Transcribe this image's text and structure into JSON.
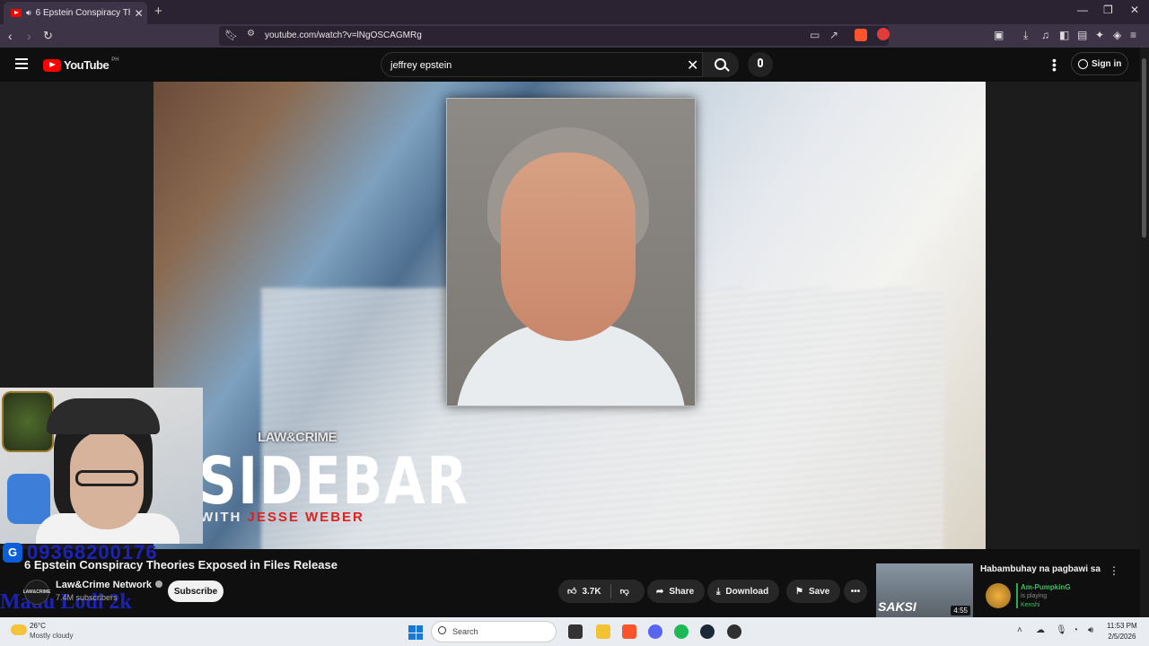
{
  "browser": {
    "tab_title": "6 Epstein Conspiracy Theorie",
    "url": "youtube.com/watch?v=lNgOSCAGMRg"
  },
  "youtube": {
    "logo_text": "YouTube",
    "country_code": "PH",
    "search_query": "jeffrey epstein",
    "sign_in": "Sign in"
  },
  "video": {
    "brand": "LAW&CRIME",
    "show_title": "SIDEBAR",
    "with_text": "WITH",
    "host": "JESSE WEBER",
    "title": "6 Epstein Conspiracy Theories Exposed in Files Release",
    "channel_name": "Law&Crime Network",
    "channel_avatar_text": "LAW&CRIME",
    "subscribers": "7.4M subscribers",
    "subscribe_label": "Subscribe",
    "likes": "3.7K",
    "share_label": "Share",
    "download_label": "Download",
    "save_label": "Save"
  },
  "overlay": {
    "number": "09368200176",
    "lodi": "Mauu Lodi 2k"
  },
  "mini_player": {
    "title": "Habambuhay na pagbawi sa",
    "thumb_text": "SAKSI",
    "duration": "4:55",
    "streamer": "Am-PumpkinG",
    "status": "is playing",
    "game": "Kenshi"
  },
  "taskbar": {
    "temperature": "26°C",
    "weather": "Mostly cloudy",
    "search_placeholder": "Search",
    "time": "11:53 PM",
    "date": "2/5/2026"
  },
  "colors": {
    "youtube_red": "#ff0000",
    "browser_bg": "#3e3447",
    "page_bg": "#0f0f0f",
    "host_name_red": "#dd2222"
  }
}
